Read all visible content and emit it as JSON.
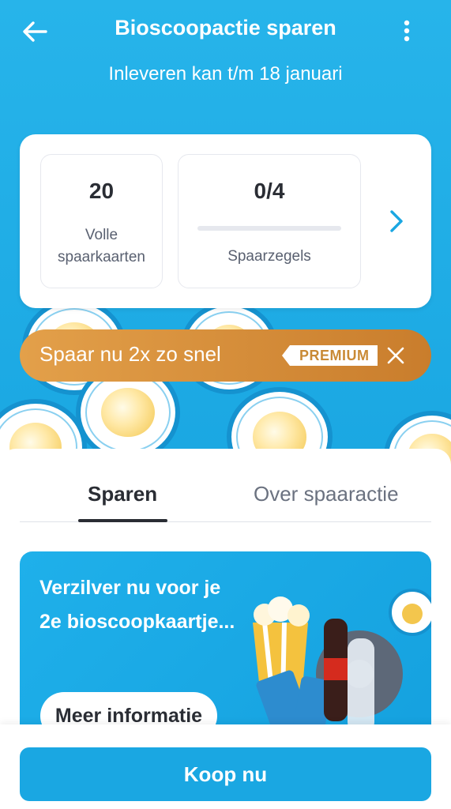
{
  "header": {
    "title": "Bioscoopactie sparen",
    "subtitle": "Inleveren kan t/m 18 januari"
  },
  "stats": {
    "full_cards_value": "20",
    "full_cards_label": "Volle spaarkaarten",
    "stamps_value": "0/4",
    "stamps_progress": 0,
    "stamps_label": "Spaarzegels"
  },
  "premium_banner": {
    "text": "Spaar nu 2x zo snel",
    "badge": "PREMIUM"
  },
  "tabs": [
    {
      "label": "Sparen",
      "active": true
    },
    {
      "label": "Over spaaractie",
      "active": false
    }
  ],
  "promo": {
    "text": "Verzilver nu voor je 2e bioscoopkaartje...",
    "button_label": "Meer informatie"
  },
  "footer": {
    "buy_button_label": "Koop nu"
  },
  "colors": {
    "brand_blue": "#1aa7e2",
    "premium_orange": "#c97d2c",
    "text_dark": "#2a2d34"
  },
  "icons": {
    "back": "arrow-left-icon",
    "more": "more-vertical-icon",
    "next": "chevron-right-icon",
    "close": "close-icon"
  }
}
